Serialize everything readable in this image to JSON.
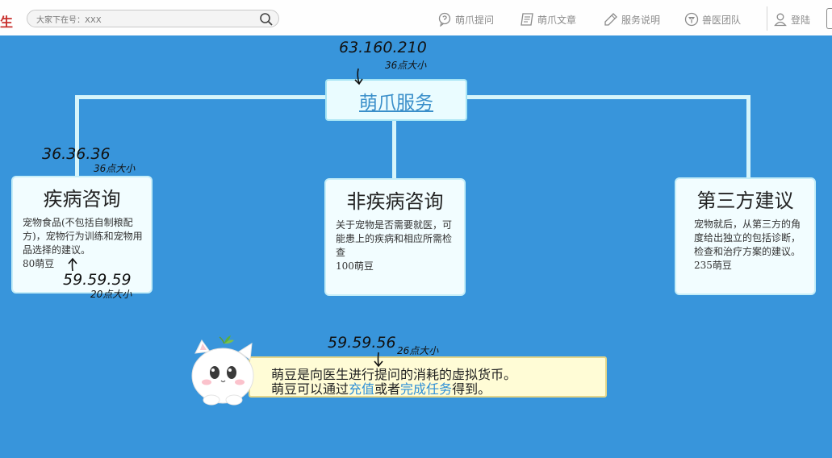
{
  "header": {
    "brand": "生",
    "search_placeholder": "大家下在号：XXX",
    "nav": [
      {
        "label": "萌爪提问",
        "icon": "question-bubble-icon"
      },
      {
        "label": "萌爪文章",
        "icon": "article-icon"
      },
      {
        "label": "服务说明",
        "icon": "pen-icon"
      },
      {
        "label": "兽医团队",
        "icon": "team-icon"
      }
    ],
    "login": {
      "label": "登陆",
      "icon": "user-icon"
    }
  },
  "root": {
    "label": "萌爪服务"
  },
  "cards": [
    {
      "title": "疾病咨询",
      "desc": "宠物食品(不包括自制粮配方)，宠物行为训练和宠物用品选择的建议。",
      "price": "80萌豆"
    },
    {
      "title": "非疾病咨询",
      "desc": "关于宠物是否需要就医，可能患上的疾病和相应所需检查",
      "price": "100萌豆"
    },
    {
      "title": "第三方建议",
      "desc": "宠物就后，从第三方的角度给出独立的包括诊断，检查和治疗方案的建议。235萌豆",
      "price": ""
    }
  ],
  "info": {
    "line1": "萌豆是向医生进行提问的消耗的虚拟货币。",
    "line2_a": "萌豆可以通过",
    "link1": "充值",
    "line2_b": "或者",
    "link2": "完成任务",
    "line2_c": "得到。"
  },
  "annotations": {
    "root_color": "63.160.210",
    "root_size": "36点大小",
    "title_color": "36.36.36",
    "title_size": "36点大小",
    "desc_color": "59.59.59",
    "desc_size": "20点大小",
    "info_color": "59.59.56",
    "info_size": "26点大小"
  },
  "colors": {
    "background": "#3895db",
    "connector": "#d6f5fb",
    "card_bg": "#f2fdff",
    "info_bg": "#fffcd6",
    "link": "#2f8fd6",
    "brand": "#c8302d"
  }
}
